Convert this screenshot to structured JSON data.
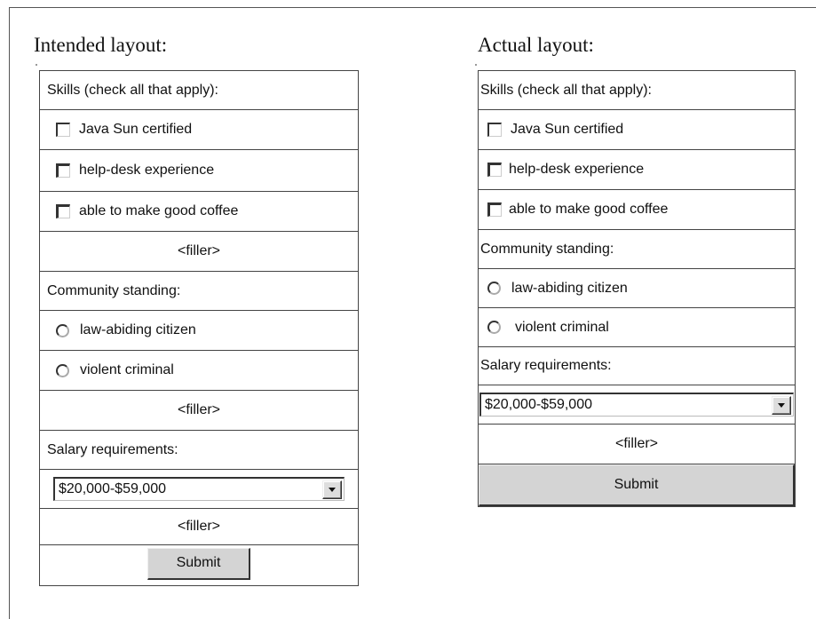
{
  "intended": {
    "heading": "Intended layout:",
    "skills_label": "Skills (check all that apply):",
    "skills": [
      "Java Sun certified",
      "help-desk experience",
      "able to make good coffee"
    ],
    "filler": "<filler>",
    "community_label": "Community standing:",
    "community": [
      "law-abiding citizen",
      "violent criminal"
    ],
    "salary_label": "Salary requirements:",
    "salary_value": "$20,000-$59,000",
    "submit": "Submit"
  },
  "actual": {
    "heading": "Actual layout:",
    "skills_label": "Skills (check all that apply):",
    "skills": [
      "Java Sun certified",
      "help-desk experience",
      "able to make good coffee"
    ],
    "community_label": "Community standing:",
    "community": [
      "law-abiding citizen",
      "violent criminal"
    ],
    "salary_label": "Salary requirements:",
    "salary_value": "$20,000-$59,000",
    "filler": "<filler>",
    "submit": "Submit"
  }
}
